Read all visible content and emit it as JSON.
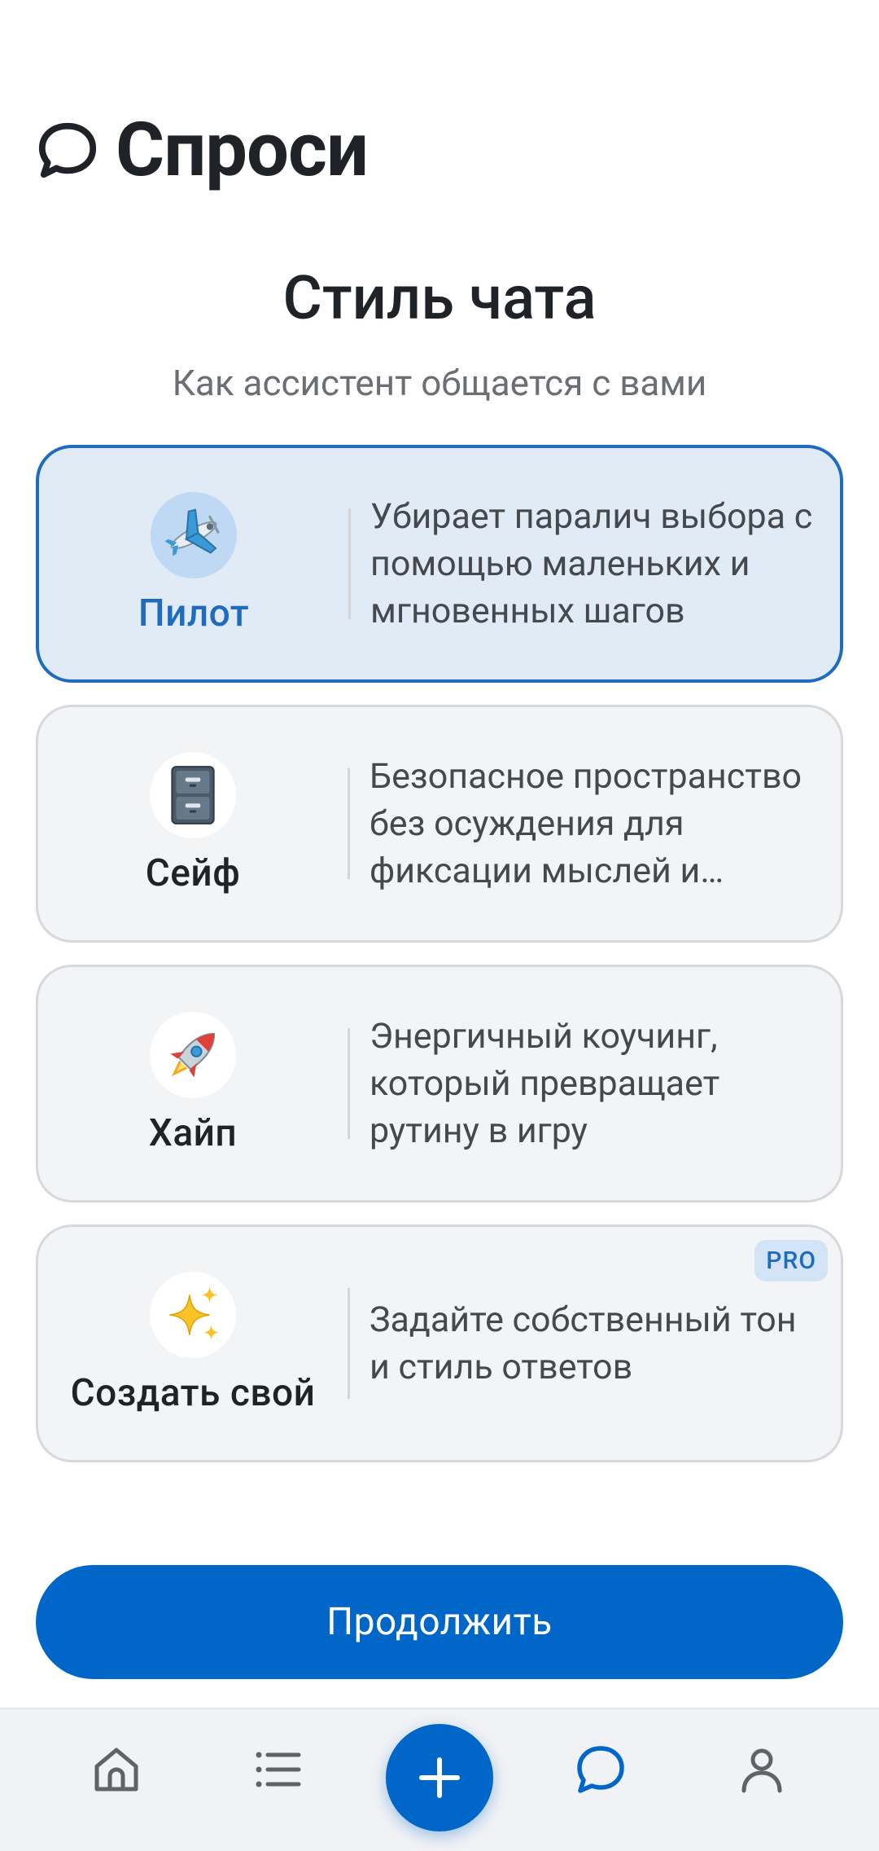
{
  "header": {
    "app_title": "Спроси",
    "icon": "chat-bubble-icon"
  },
  "page": {
    "title": "Стиль чата",
    "subtitle": "Как ассистент общается с вами"
  },
  "styles": [
    {
      "name": "Пилот",
      "emoji": "airplane",
      "selected": true,
      "description": "Убирает паралич выбора с помощью маленьких и мгновенных шагов"
    },
    {
      "name": "Сейф",
      "emoji": "file-cabinet",
      "selected": false,
      "description": "Безопасное пространство без осуждения для фиксации мыслей и чувств"
    },
    {
      "name": "Хайп",
      "emoji": "rocket",
      "selected": false,
      "description": "Энергичный коучинг, который превращает рутину в игру"
    },
    {
      "name": "Создать свой",
      "emoji": "sparkles",
      "selected": false,
      "badge": "PRO",
      "description": "Задайте собственный тон и стиль ответов"
    }
  ],
  "continue_label": "Продолжить",
  "bottom_nav": [
    "home-icon",
    "list-icon",
    "plus-icon",
    "chat-icon",
    "profile-icon"
  ],
  "colors": {
    "accent": "#0067c9",
    "selected_bg": "#e1ebf6",
    "selected_border": "#1f6cbf",
    "card_bg": "#f3f4f6"
  }
}
